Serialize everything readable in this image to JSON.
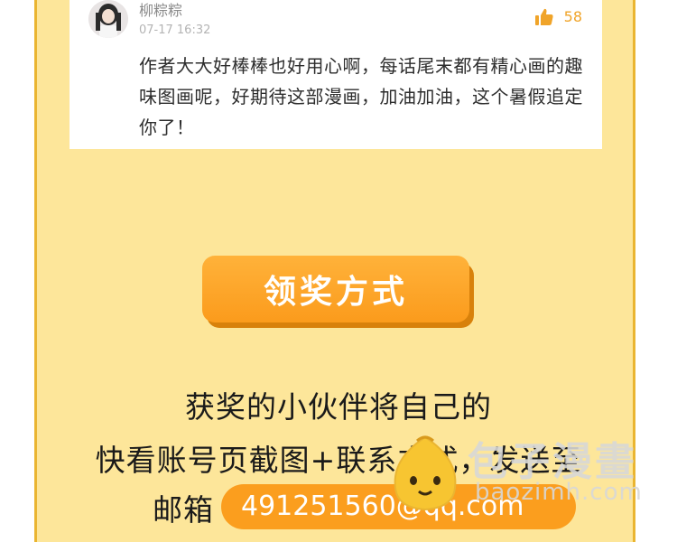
{
  "comment": {
    "username": "柳粽粽",
    "time": "07-17 16:32",
    "likes": "58",
    "text": "作者大大好棒棒也好用心啊，每话尾末都有精心画的趣味图画呢，好期待这部漫画，加油加油，这个暑假追定你了！"
  },
  "award": {
    "button_label": "领奖方式",
    "line1": "获奖的小伙伴将自己的",
    "line2": "快看账号页截图+联系方式，发送至",
    "email_label": "邮箱",
    "email": "491251560@qq.com"
  },
  "watermark": {
    "title": "包子漫畫",
    "domain": "baozimh.com"
  },
  "colors": {
    "panel": "#fde69a",
    "border": "#eab531",
    "button": "#fb9e1e",
    "like": "#f0a429"
  }
}
